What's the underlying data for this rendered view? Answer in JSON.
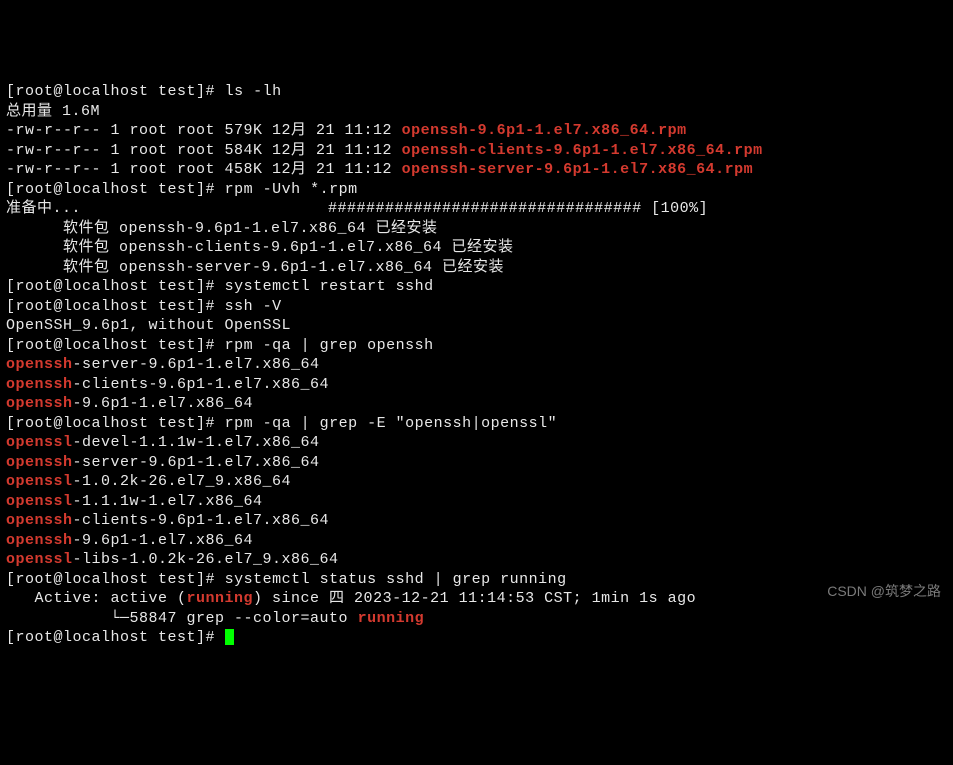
{
  "prompt": "[root@localhost test]#",
  "cmd": {
    "ls": "ls -lh",
    "rpm_install": "rpm -Uvh *.rpm",
    "restart": "systemctl restart sshd",
    "ssh_v": "ssh -V",
    "rpm_qa1": "rpm -qa | grep openssh",
    "rpm_qa2": "rpm -qa | grep -E \"openssh|openssl\"",
    "status": "systemctl status sshd | grep running"
  },
  "ls_header": "总用量 1.6M",
  "ls_rows": [
    {
      "perm": "-rw-r--r-- 1 root root 579K 12月 21 11:12 ",
      "file": "openssh-9.6p1-1.el7.x86_64.rpm"
    },
    {
      "perm": "-rw-r--r-- 1 root root 584K 12月 21 11:12 ",
      "file": "openssh-clients-9.6p1-1.el7.x86_64.rpm"
    },
    {
      "perm": "-rw-r--r-- 1 root root 458K 12月 21 11:12 ",
      "file": "openssh-server-9.6p1-1.el7.x86_64.rpm"
    }
  ],
  "preparing": "准备中...                          ################################# [100%]",
  "installed": [
    "软件包 openssh-9.6p1-1.el7.x86_64 已经安装",
    "软件包 openssh-clients-9.6p1-1.el7.x86_64 已经安装",
    "软件包 openssh-server-9.6p1-1.el7.x86_64 已经安装"
  ],
  "ssh_version": "OpenSSH_9.6p1, without OpenSSL",
  "qa1": [
    {
      "hl": "openssh",
      "rest": "-server-9.6p1-1.el7.x86_64"
    },
    {
      "hl": "openssh",
      "rest": "-clients-9.6p1-1.el7.x86_64"
    },
    {
      "hl": "openssh",
      "rest": "-9.6p1-1.el7.x86_64"
    }
  ],
  "qa2": [
    {
      "hl": "openssl",
      "rest": "-devel-1.1.1w-1.el7.x86_64"
    },
    {
      "hl": "openssh",
      "rest": "-server-9.6p1-1.el7.x86_64"
    },
    {
      "hl": "openssl",
      "rest": "-1.0.2k-26.el7_9.x86_64"
    },
    {
      "hl": "openssl",
      "rest": "-1.1.1w-1.el7.x86_64"
    },
    {
      "hl": "openssh",
      "rest": "-clients-9.6p1-1.el7.x86_64"
    },
    {
      "hl": "openssh",
      "rest": "-9.6p1-1.el7.x86_64"
    },
    {
      "hl": "openssl",
      "rest": "-libs-1.0.2k-26.el7_9.x86_64"
    }
  ],
  "status_out": {
    "l1a": "   Active: active (",
    "l1b": "running",
    "l1c": ") since 四 2023-12-21 11:14:53 CST; 1min 1s ago",
    "l2a": "           └─58847 grep --color=auto ",
    "l2b": "running"
  },
  "watermark": "CSDN @筑梦之路"
}
